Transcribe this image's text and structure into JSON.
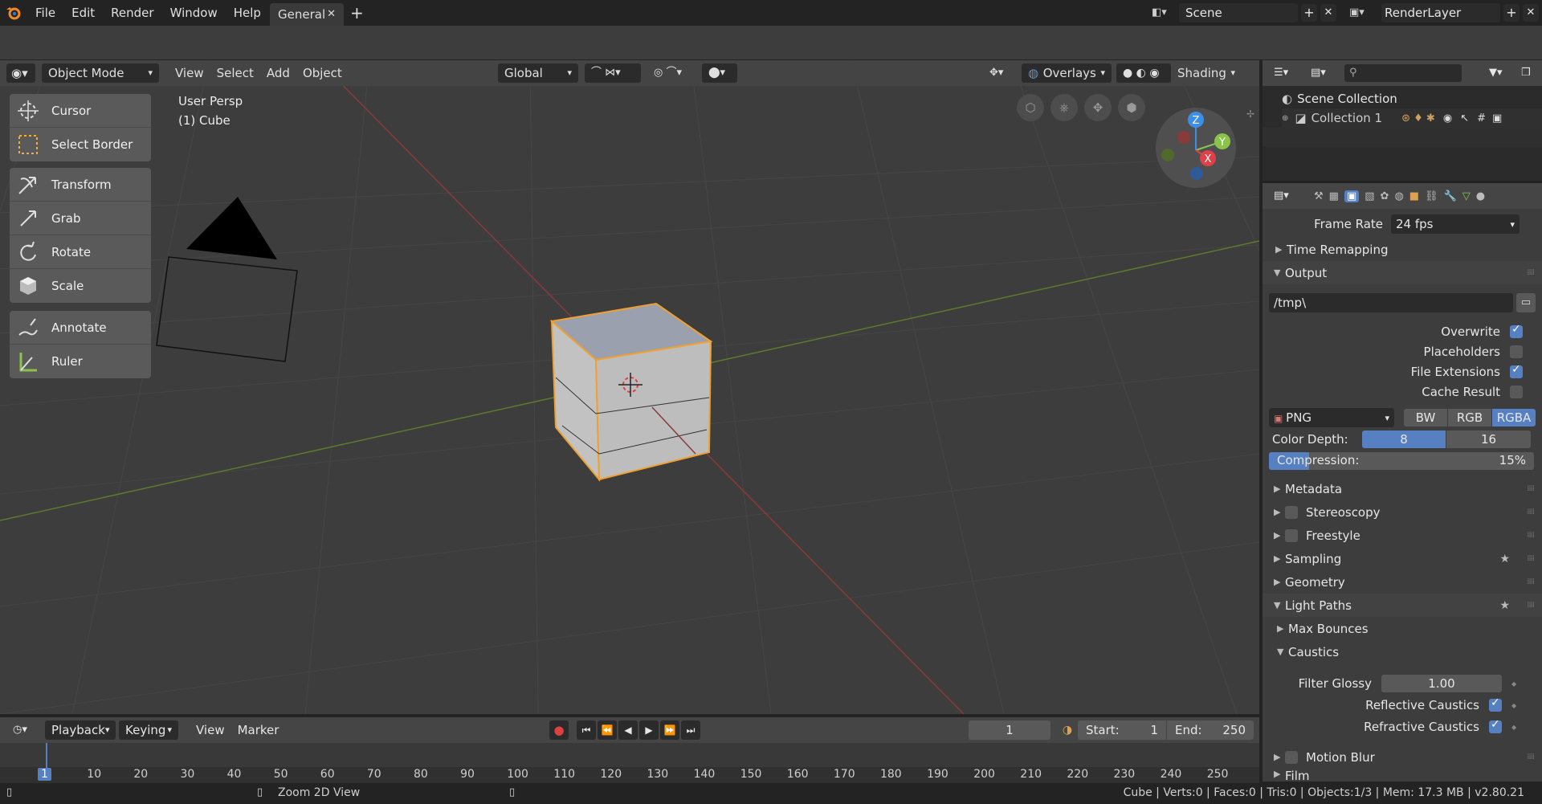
{
  "topbar": {
    "menus": [
      "File",
      "Edit",
      "Render",
      "Window",
      "Help"
    ],
    "workspace_tab": "General",
    "add_tab": "+",
    "scene": "Scene",
    "render_layer": "RenderLayer"
  },
  "viewport": {
    "mode": "Object Mode",
    "menus": [
      "View",
      "Select",
      "Add",
      "Object"
    ],
    "orientation": "Global",
    "overlays": "Overlays",
    "shading": "Shading",
    "info_line1": "User Persp",
    "info_line2": "(1) Cube",
    "tools": {
      "cursor": "Cursor",
      "select_border": "Select Border",
      "transform": "Transform",
      "grab": "Grab",
      "rotate": "Rotate",
      "scale": "Scale",
      "annotate": "Annotate",
      "ruler": "Ruler"
    },
    "gizmo": {
      "z": "Z",
      "y": "Y",
      "x": "X"
    }
  },
  "outliner": {
    "scene_collection": "Scene Collection",
    "collection": "Collection 1"
  },
  "properties": {
    "frame_rate_label": "Frame Rate",
    "frame_rate_value": "24 fps",
    "time_remapping": "Time Remapping",
    "output": "Output",
    "path": "/tmp\\",
    "overwrite": "Overwrite",
    "placeholders": "Placeholders",
    "file_extensions": "File Extensions",
    "cache_result": "Cache Result",
    "format": "PNG",
    "bw": "BW",
    "rgb": "RGB",
    "rgba": "RGBA",
    "color_depth_label": "Color Depth:",
    "depth_8": "8",
    "depth_16": "16",
    "compression_label": "Compression:",
    "compression_value": "15%",
    "compression_fraction": 0.15,
    "metadata": "Metadata",
    "stereoscopy": "Stereoscopy",
    "freestyle": "Freestyle",
    "sampling": "Sampling",
    "geometry": "Geometry",
    "light_paths": "Light Paths",
    "max_bounces": "Max Bounces",
    "caustics": "Caustics",
    "filter_glossy_label": "Filter Glossy",
    "filter_glossy_value": "1.00",
    "reflective_caustics": "Reflective Caustics",
    "refractive_caustics": "Refractive Caustics",
    "motion_blur": "Motion Blur",
    "film": "Film",
    "checks": {
      "overwrite": true,
      "placeholders": false,
      "file_extensions": true,
      "cache_result": false,
      "reflective": true,
      "refractive": true
    }
  },
  "timeline": {
    "menus": [
      "Playback",
      "Keying",
      "View",
      "Marker"
    ],
    "current_frame": "1",
    "start_label": "Start:",
    "start_value": "1",
    "end_label": "End:",
    "end_value": "250",
    "ruler_ticks": [
      "1",
      "10",
      "20",
      "30",
      "40",
      "50",
      "60",
      "70",
      "80",
      "90",
      "100",
      "110",
      "120",
      "130",
      "140",
      "150",
      "160",
      "170",
      "180",
      "190",
      "200",
      "210",
      "220",
      "230",
      "240",
      "250"
    ]
  },
  "statusbar": {
    "hint": "Zoom 2D View",
    "stats": "Cube | Verts:0 | Faces:0 | Tris:0 | Objects:1/3 | Mem: 17.3 MB | v2.80.21"
  },
  "colors": {
    "accent": "#5680c2",
    "selection": "#f0a030",
    "x_axis": "#e0404a",
    "y_axis": "#8bc34a",
    "z_axis": "#3e8ee8"
  }
}
